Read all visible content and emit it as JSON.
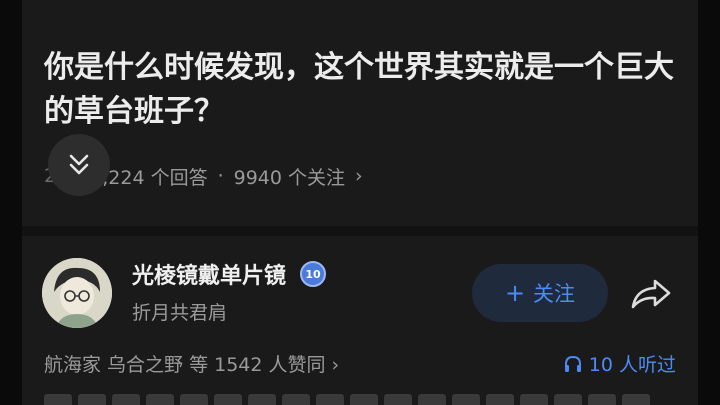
{
  "question": {
    "title": "你是什么时候发现，这个世界其实就是一个巨大的草台班子？",
    "stats_prefix": "2",
    "answers": "2,224 个回答",
    "followers": "9940 个关注",
    "dot": "·",
    "chevron": "›"
  },
  "answer": {
    "author_name": "光棱镜戴单片镜",
    "badge": "10",
    "author_subtitle": "折月共君肩",
    "follow_label": "关注",
    "follow_plus": "+",
    "voters": "航海家 乌合之野 等 1542 人赞同 ›",
    "listeners": "10 人听过"
  },
  "colors": {
    "accent": "#4c8bf5",
    "background": "#1a1a1a"
  },
  "icons": [
    "chevron-double-down-icon",
    "share-arrow-icon",
    "headphones-icon",
    "verified-badge-icon"
  ]
}
